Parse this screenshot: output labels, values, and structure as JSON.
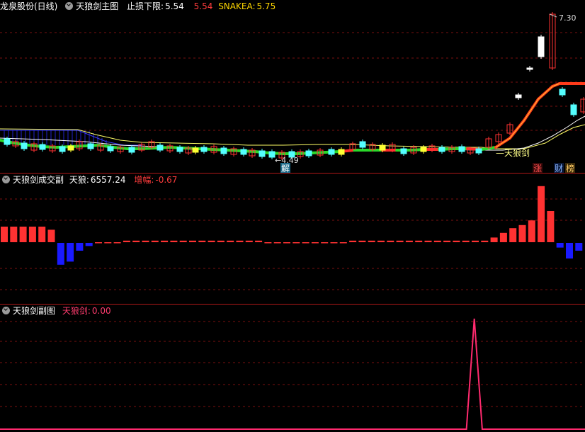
{
  "main_panel": {
    "stock_name": "龙泉股份(日线)",
    "indicator_name": "天狼剑主图",
    "stop_label": "止损下限:",
    "stop_value": "5.54",
    "stop_value2": "5.54",
    "snake_label": "SNAKEA:",
    "snake_value": "5.75",
    "high_label": "7.30",
    "low_label": "4.49",
    "sword_label": "天狼剑",
    "jie_badge": "解",
    "zhang_badge": "涨",
    "cai_badge": "财",
    "bang_badge": "榜"
  },
  "vol_panel": {
    "indicator_name": "天狼剑成交副",
    "value_label": "天狼:",
    "value": "6557.24",
    "change_label": "增幅:",
    "change_value": "-0.67"
  },
  "sub_panel": {
    "indicator_name": "天狼剑副图",
    "value_label": "天狼剑:",
    "value": "0.00"
  },
  "colors": {
    "up": "#ff3232",
    "down": "#54ffff",
    "grid": "#7a1010",
    "line_white": "#ffffff",
    "line_yellow": "#ffff66",
    "blue_bar": "#1a1aff",
    "pink_line": "#ff2a6e"
  },
  "chart_data": [
    {
      "type": "bar",
      "title": "天狼剑成交副",
      "values": [
        10,
        10,
        10,
        10,
        10,
        8,
        -14,
        -12,
        -5,
        -2,
        0,
        0,
        0,
        1,
        1,
        1,
        1,
        1,
        1,
        1,
        1,
        1,
        1,
        1,
        1,
        1,
        1,
        1,
        0,
        0,
        0,
        0,
        0,
        0,
        0,
        0,
        0,
        1,
        1,
        1,
        1,
        1,
        1,
        1,
        1,
        1,
        1,
        1,
        1,
        1,
        1,
        1,
        3,
        6,
        9,
        11,
        14,
        36,
        20,
        -3,
        -10,
        -5
      ]
    },
    {
      "type": "line",
      "title": "天狼剑副图",
      "values": [
        0,
        0,
        0,
        0,
        0,
        0,
        0,
        0,
        0,
        0,
        0,
        0,
        0,
        0,
        0,
        0,
        0,
        0,
        0,
        0,
        0,
        0,
        0,
        0,
        0,
        0,
        0,
        0,
        0,
        0,
        0,
        0,
        0,
        0,
        0,
        0,
        0,
        0,
        0,
        0,
        0,
        0,
        0,
        0,
        0,
        0,
        0,
        0,
        0,
        0,
        0,
        0,
        0,
        0,
        0,
        0,
        0,
        0,
        0,
        0,
        1,
        0,
        0,
        0,
        0,
        0,
        0,
        0,
        0,
        0,
        0,
        0,
        0,
        0,
        0
      ]
    }
  ]
}
